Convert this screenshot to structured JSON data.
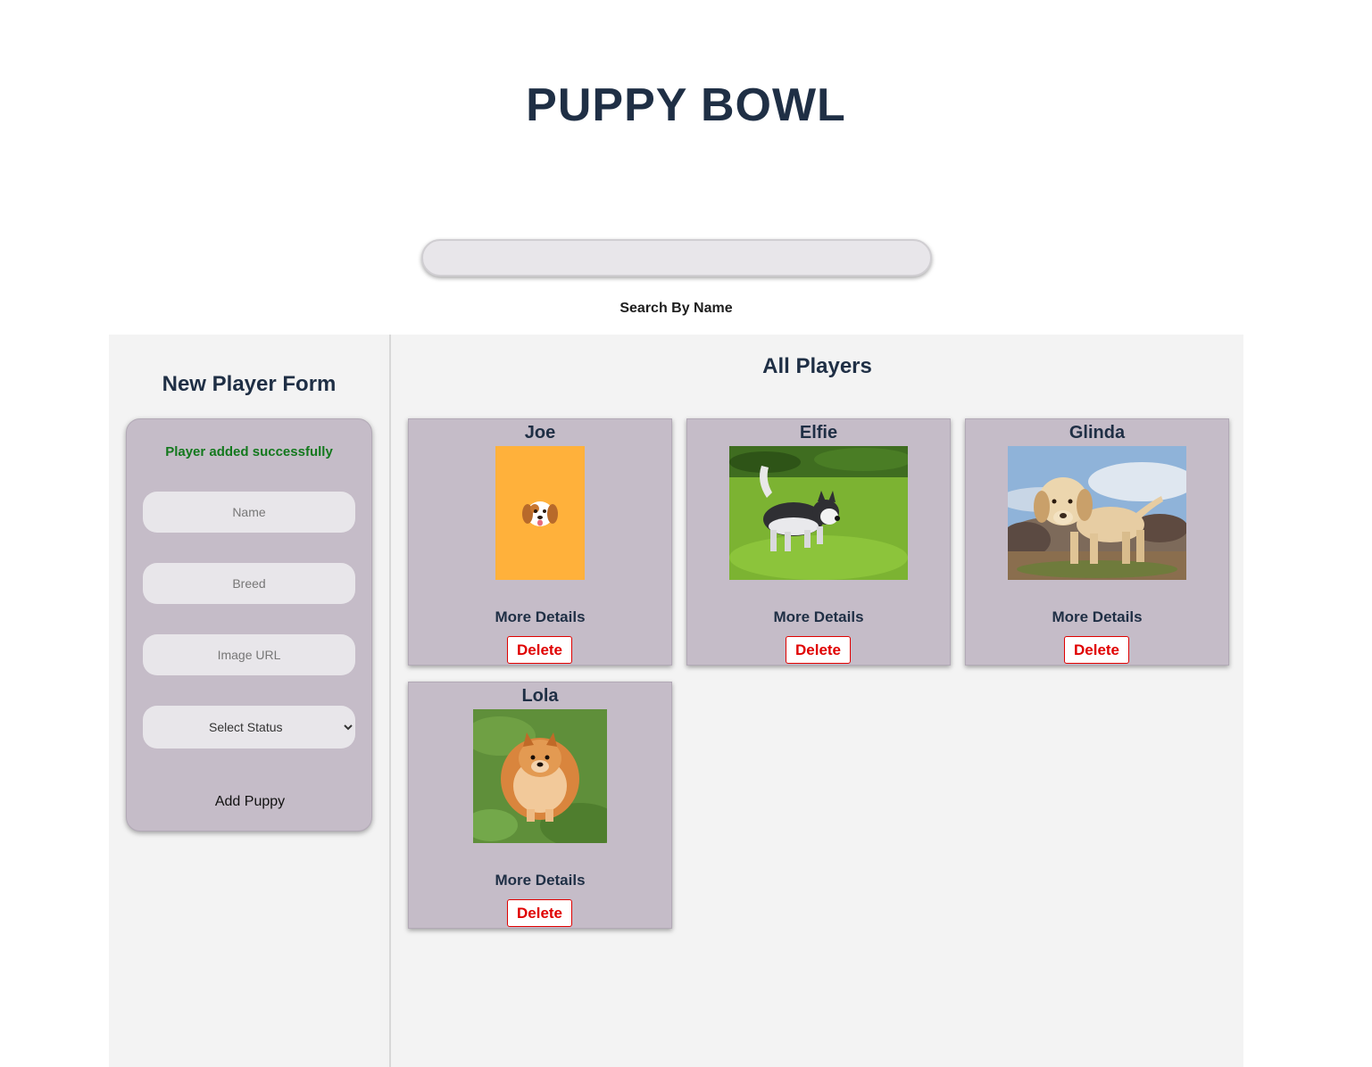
{
  "header": {
    "title": "PUPPY BOWL"
  },
  "search": {
    "value": "",
    "label": "Search By Name"
  },
  "form": {
    "title": "New Player Form",
    "success_message": "Player added successfully",
    "name_placeholder": "Name",
    "breed_placeholder": "Breed",
    "image_placeholder": "Image URL",
    "status_selected": "Select Status",
    "submit_label": "Add Puppy"
  },
  "players_section": {
    "title": "All Players",
    "players": [
      {
        "name": "Joe",
        "image": "cartoon-dog-face-placeholder",
        "details_label": "More Details",
        "delete_label": "Delete"
      },
      {
        "name": "Elfie",
        "image": "husky-puppy-on-grass",
        "details_label": "More Details",
        "delete_label": "Delete"
      },
      {
        "name": "Glinda",
        "image": "labrador-puppy-on-rocks",
        "details_label": "More Details",
        "delete_label": "Delete"
      },
      {
        "name": "Lola",
        "image": "pomeranian-on-grass",
        "details_label": "More Details",
        "delete_label": "Delete"
      }
    ]
  },
  "colors": {
    "title": "#1f2f45",
    "card_background": "#c5bcc8",
    "success": "#13781d",
    "delete": "#e00000",
    "panel_background": "#f3f3f3"
  }
}
